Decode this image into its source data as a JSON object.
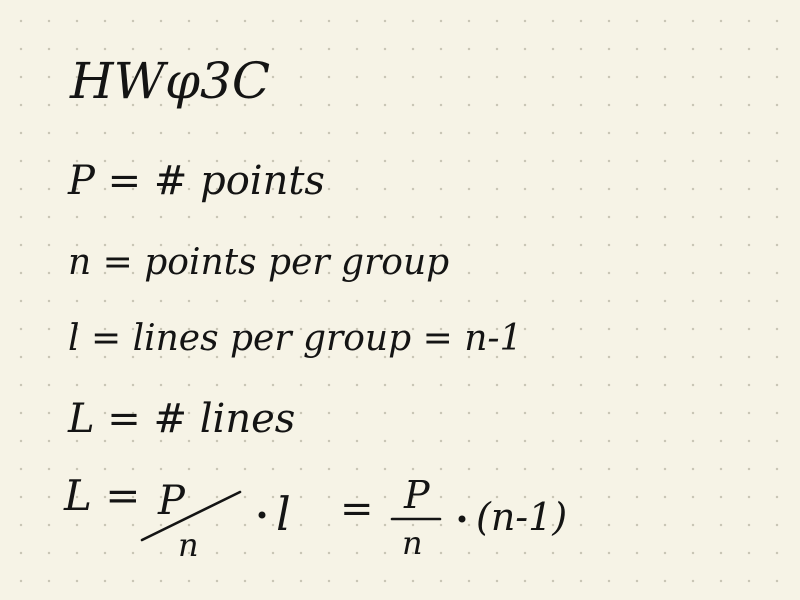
{
  "note": {
    "title": "HWφ3C",
    "lines": [
      "P = # points",
      "n = points per group",
      "l = lines per group = n-1",
      "L = # lines"
    ],
    "equation": {
      "lhs": "L =",
      "frac1_num": "P",
      "frac1_den": "n",
      "times_l": "l",
      "equals": "=",
      "frac2_num": "P",
      "frac2_den": "n",
      "tail": "(n-1)"
    }
  }
}
